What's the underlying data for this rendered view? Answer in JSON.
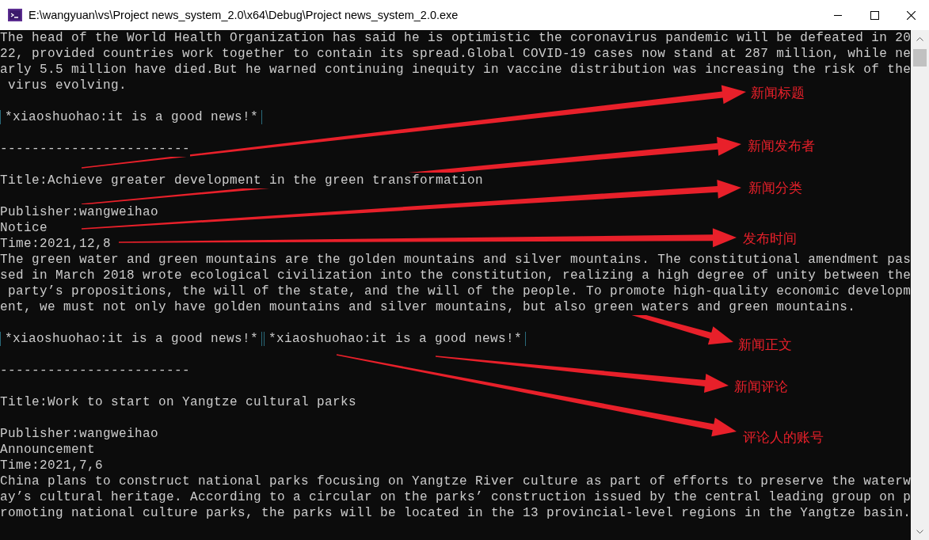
{
  "window": {
    "title": "E:\\wangyuan\\vs\\Project news_system_2.0\\x64\\Debug\\Project news_system_2.0.exe"
  },
  "console_lines": [
    {
      "kind": "text",
      "text": "The head of the World Health Organization has said he is optimistic the coronavirus pandemic will be defeated in 20"
    },
    {
      "kind": "text",
      "text": "22, provided countries work together to contain its spread.Global COVID-19 cases now stand at 287 million, while ne"
    },
    {
      "kind": "text",
      "text": "arly 5.5 million have died.But he warned continuing inequity in vaccine distribution was increasing the risk of the"
    },
    {
      "kind": "text",
      "text": " virus evolving."
    },
    {
      "kind": "blank"
    },
    {
      "kind": "comments",
      "comments": [
        "*xiaoshuohao:it is a good news!*"
      ]
    },
    {
      "kind": "blank"
    },
    {
      "kind": "rule",
      "text": "------------------------"
    },
    {
      "kind": "blank"
    },
    {
      "kind": "text",
      "text": "Title:Achieve greater development in the green transformation"
    },
    {
      "kind": "blank"
    },
    {
      "kind": "text",
      "text": "Publisher:wangweihao"
    },
    {
      "kind": "text",
      "text": "Notice"
    },
    {
      "kind": "text",
      "text": "Time:2021,12,8"
    },
    {
      "kind": "text",
      "text": "The green water and green mountains are the golden mountains and silver mountains. The constitutional amendment pas"
    },
    {
      "kind": "text",
      "text": "sed in March 2018 wrote ecological civilization into the constitution, realizing a high degree of unity between the"
    },
    {
      "kind": "text",
      "text": " party’s propositions, the will of the state, and the will of the people. To promote high-quality economic developm"
    },
    {
      "kind": "text",
      "text": "ent, we must not only have golden mountains and silver mountains, but also green waters and green mountains."
    },
    {
      "kind": "blank"
    },
    {
      "kind": "comments",
      "comments": [
        "*xiaoshuohao:it is a good news!*",
        "*xiaoshuohao:it is a good news!*"
      ]
    },
    {
      "kind": "blank"
    },
    {
      "kind": "rule",
      "text": "------------------------"
    },
    {
      "kind": "blank"
    },
    {
      "kind": "text",
      "text": "Title:Work to start on Yangtze cultural parks"
    },
    {
      "kind": "blank"
    },
    {
      "kind": "text",
      "text": "Publisher:wangweihao"
    },
    {
      "kind": "text",
      "text": "Announcement"
    },
    {
      "kind": "text",
      "text": "Time:2021,7,6"
    },
    {
      "kind": "text",
      "text": "China plans to construct national parks focusing on Yangtze River culture as part of efforts to preserve the waterw"
    },
    {
      "kind": "text",
      "text": "ay’s cultural heritage. According to a circular on the parks’ construction issued by the central leading group on p"
    },
    {
      "kind": "text",
      "text": "romoting national culture parks, the parks will be located in the 13 provincial-level regions in the Yangtze basin."
    }
  ],
  "annotations": [
    {
      "label": "新闻标题"
    },
    {
      "label": "新闻发布者"
    },
    {
      "label": "新闻分类"
    },
    {
      "label": "发布时间"
    },
    {
      "label": "新闻正文"
    },
    {
      "label": "新闻评论"
    },
    {
      "label": "评论人的账号"
    }
  ]
}
